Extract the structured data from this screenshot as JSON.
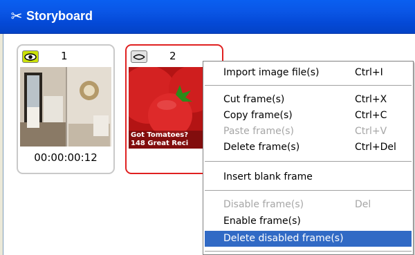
{
  "window": {
    "title": "Storyboard",
    "title_icon": "scissors-icon"
  },
  "frames": [
    {
      "number": "1",
      "timecode": "00:00:00:12",
      "enabled": true,
      "visibility_icon": "eye-open-icon",
      "thumbnail_text": ""
    },
    {
      "number": "2",
      "timecode": "",
      "enabled": false,
      "visibility_icon": "eye-closed-icon",
      "thumbnail_text_1": "Got Tomatoes?",
      "thumbnail_text_2": "148 Great Reci"
    }
  ],
  "context_menu": {
    "items": [
      {
        "label": "Import image file(s)",
        "shortcut": "Ctrl+I",
        "disabled": false
      },
      {
        "label": "Cut frame(s)",
        "shortcut": "Ctrl+X",
        "disabled": false
      },
      {
        "label": "Copy frame(s)",
        "shortcut": "Ctrl+C",
        "disabled": false
      },
      {
        "label": "Paste frame(s)",
        "shortcut": "Ctrl+V",
        "disabled": true
      },
      {
        "label": "Delete frame(s)",
        "shortcut": "Ctrl+Del",
        "disabled": false
      },
      {
        "label": "Insert blank frame",
        "shortcut": "",
        "disabled": false
      },
      {
        "label": "Disable frame(s)",
        "shortcut": "Del",
        "disabled": true
      },
      {
        "label": "Enable frame(s)",
        "shortcut": "",
        "disabled": false
      },
      {
        "label": "Delete disabled frame(s)",
        "shortcut": "",
        "disabled": false,
        "highlighted": true
      }
    ]
  },
  "colors": {
    "titlebar": "#0a56e6",
    "selection": "#316ac5",
    "selected_frame_border": "#e02020",
    "eye_on_bg": "#cbe10a"
  }
}
